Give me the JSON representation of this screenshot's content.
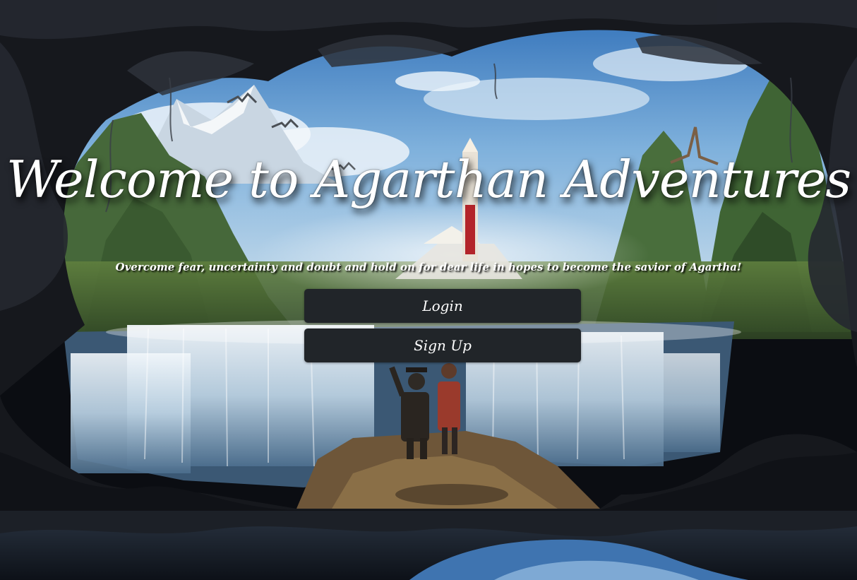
{
  "hero": {
    "title": "Welcome to Agarthan Adventures",
    "tagline": "Overcome fear, uncertainty and doubt and hold on for dear life in hopes to become the savior of Agartha!",
    "background_image": "cave-waterfall-landscape"
  },
  "actions": {
    "login_label": "Login",
    "signup_label": "Sign Up"
  },
  "colors": {
    "button_bg": "#212529",
    "text": "#ffffff"
  }
}
